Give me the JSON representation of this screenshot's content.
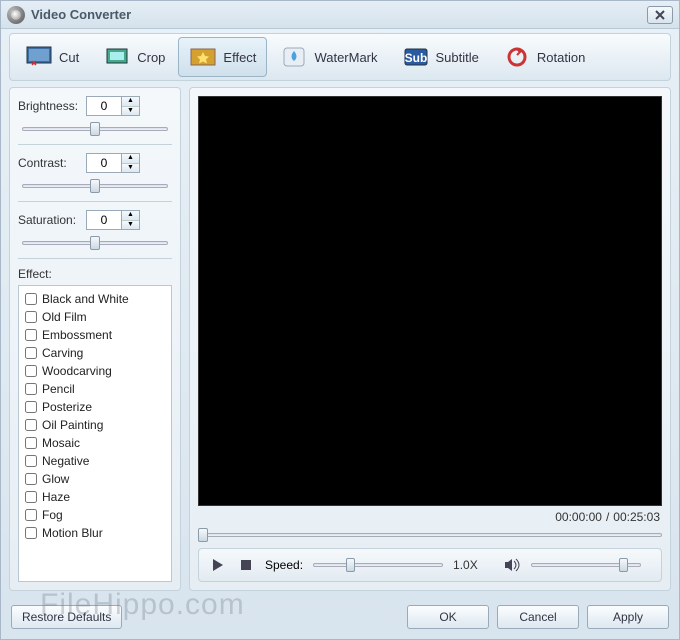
{
  "window": {
    "title": "Video Converter"
  },
  "toolbar": {
    "items": [
      {
        "id": "cut",
        "label": "Cut"
      },
      {
        "id": "crop",
        "label": "Crop"
      },
      {
        "id": "effect",
        "label": "Effect"
      },
      {
        "id": "watermark",
        "label": "WaterMark"
      },
      {
        "id": "subtitle",
        "label": "Subtitle"
      },
      {
        "id": "rotation",
        "label": "Rotation"
      }
    ],
    "active": "effect"
  },
  "controls": {
    "brightness": {
      "label": "Brightness:",
      "value": "0",
      "slider": 50
    },
    "contrast": {
      "label": "Contrast:",
      "value": "0",
      "slider": 50
    },
    "saturation": {
      "label": "Saturation:",
      "value": "0",
      "slider": 50
    }
  },
  "effects": {
    "label": "Effect:",
    "items": [
      "Black and White",
      "Old Film",
      "Embossment",
      "Carving",
      "Woodcarving",
      "Pencil",
      "Posterize",
      "Oil Painting",
      "Mosaic",
      "Negative",
      "Glow",
      "Haze",
      "Fog",
      "Motion Blur"
    ]
  },
  "player": {
    "current_time": "00:00:00",
    "divider": "/",
    "total_time": "00:25:03",
    "seek_pct": 0,
    "speed_label": "Speed:",
    "speed_value": "1.0X",
    "speed_pct": 25,
    "volume_pct": 80
  },
  "footer": {
    "restore": "Restore Defaults",
    "ok": "OK",
    "cancel": "Cancel",
    "apply": "Apply"
  },
  "watermark_text": "FileHippo.com"
}
